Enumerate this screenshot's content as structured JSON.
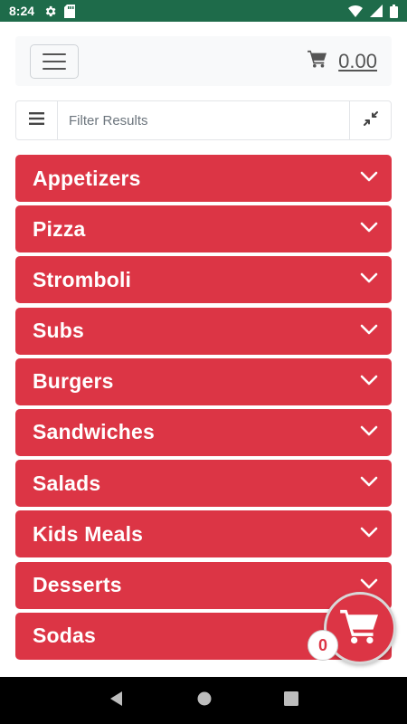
{
  "status_bar": {
    "time": "8:24",
    "icons_left": [
      "gear-icon",
      "sd-card-icon"
    ],
    "icons_right": [
      "wifi-icon",
      "signal-icon",
      "battery-icon"
    ],
    "background": "#1e6b4a"
  },
  "header": {
    "menu_icon": "hamburger-icon",
    "cart_icon": "cart-icon",
    "cart_total": "0.00"
  },
  "filter": {
    "placeholder": "Filter Results",
    "value": "",
    "menu_icon": "list-icon",
    "collapse_icon": "compress-icon"
  },
  "categories": [
    {
      "label": "Appetizers"
    },
    {
      "label": "Pizza"
    },
    {
      "label": "Stromboli"
    },
    {
      "label": "Subs"
    },
    {
      "label": "Burgers"
    },
    {
      "label": "Sandwiches"
    },
    {
      "label": "Salads"
    },
    {
      "label": "Kids Meals"
    },
    {
      "label": "Desserts"
    },
    {
      "label": "Sodas"
    }
  ],
  "floating_cart": {
    "count": "0",
    "icon": "cart-icon"
  },
  "nav_bar": {
    "buttons": [
      "back-icon",
      "home-icon",
      "recents-icon"
    ]
  },
  "colors": {
    "accent": "#dc3545",
    "header_bg": "#f8f9fa"
  }
}
